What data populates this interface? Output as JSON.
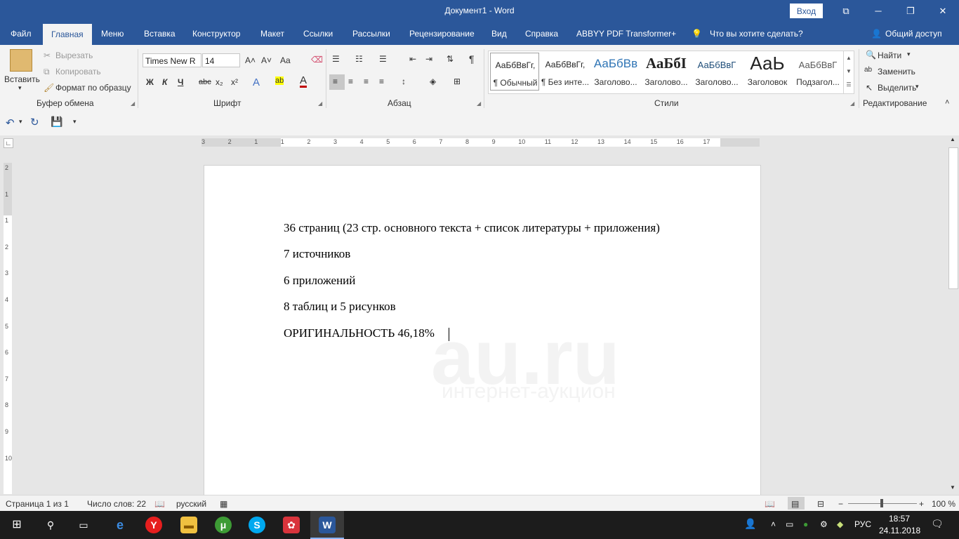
{
  "window": {
    "title": "Документ1  -  Word",
    "login": "Вход",
    "controls": {
      "ribbon_display": "⧉",
      "minimize": "─",
      "restore": "❐",
      "close": "✕"
    }
  },
  "tabs": [
    "Файл",
    "Главная",
    "Меню",
    "Вставка",
    "Конструктор",
    "Макет",
    "Ссылки",
    "Рассылки",
    "Рецензирование",
    "Вид",
    "Справка",
    "ABBYY PDF Transformer+"
  ],
  "tell_me": "Что вы хотите сделать?",
  "share": "Общий доступ",
  "ribbon": {
    "clipboard": {
      "paste": "Вставить",
      "cut": "Вырезать",
      "copy": "Копировать",
      "format_painter": "Формат по образцу",
      "label": "Буфер обмена"
    },
    "font": {
      "name": "Times New R",
      "size": "14",
      "bold": "Ж",
      "italic": "К",
      "underline": "Ч",
      "strike": "abc",
      "sub": "x₂",
      "sup": "x²",
      "grow": "A˄",
      "shrink": "A˅",
      "case": "Aa",
      "label": "Шрифт"
    },
    "paragraph": {
      "label": "Абзац",
      "pilcrow": "¶"
    },
    "styles": {
      "label": "Стили",
      "items": [
        {
          "preview": "АаБбВвГг,",
          "name": "¶ Обычный"
        },
        {
          "preview": "АаБбВвГг,",
          "name": "¶ Без инте..."
        },
        {
          "preview": "АаБбВв",
          "name": "Заголово..."
        },
        {
          "preview": "АаБбІ",
          "name": "Заголово..."
        },
        {
          "preview": "АаБбВвГ",
          "name": "Заголово..."
        },
        {
          "preview": "АаЬ",
          "name": "Заголовок"
        },
        {
          "preview": "АаБбВвГ",
          "name": "Подзагол..."
        }
      ]
    },
    "editing": {
      "find": "Найти",
      "replace": "Заменить",
      "select": "Выделить",
      "label": "Редактирование"
    }
  },
  "ruler": {
    "h_labels": [
      "3",
      "2",
      "1",
      "1",
      "2",
      "3",
      "4",
      "5",
      "6",
      "7",
      "8",
      "9",
      "10",
      "11",
      "12",
      "13",
      "14",
      "15",
      "16",
      "17"
    ],
    "v_labels": [
      "2",
      "1",
      "1",
      "2",
      "3",
      "4",
      "5",
      "6",
      "7",
      "8",
      "9",
      "10"
    ]
  },
  "document": {
    "lines": [
      "36 страниц (23 стр. основного текста + список литературы + приложения)",
      "7 источников",
      "6 приложений",
      "8 таблиц и 5 рисунков",
      "ОРИГИНАЛЬНОСТЬ 46,18%"
    ],
    "watermark": "au.ru",
    "watermark_sub": "интернет-аукцион"
  },
  "status": {
    "page": "Страница 1 из 1",
    "words": "Число слов: 22",
    "language": "русский",
    "zoom": "100 %"
  },
  "taskbar": {
    "lang": "РУС",
    "time": "18:57",
    "date": "24.11.2018"
  }
}
